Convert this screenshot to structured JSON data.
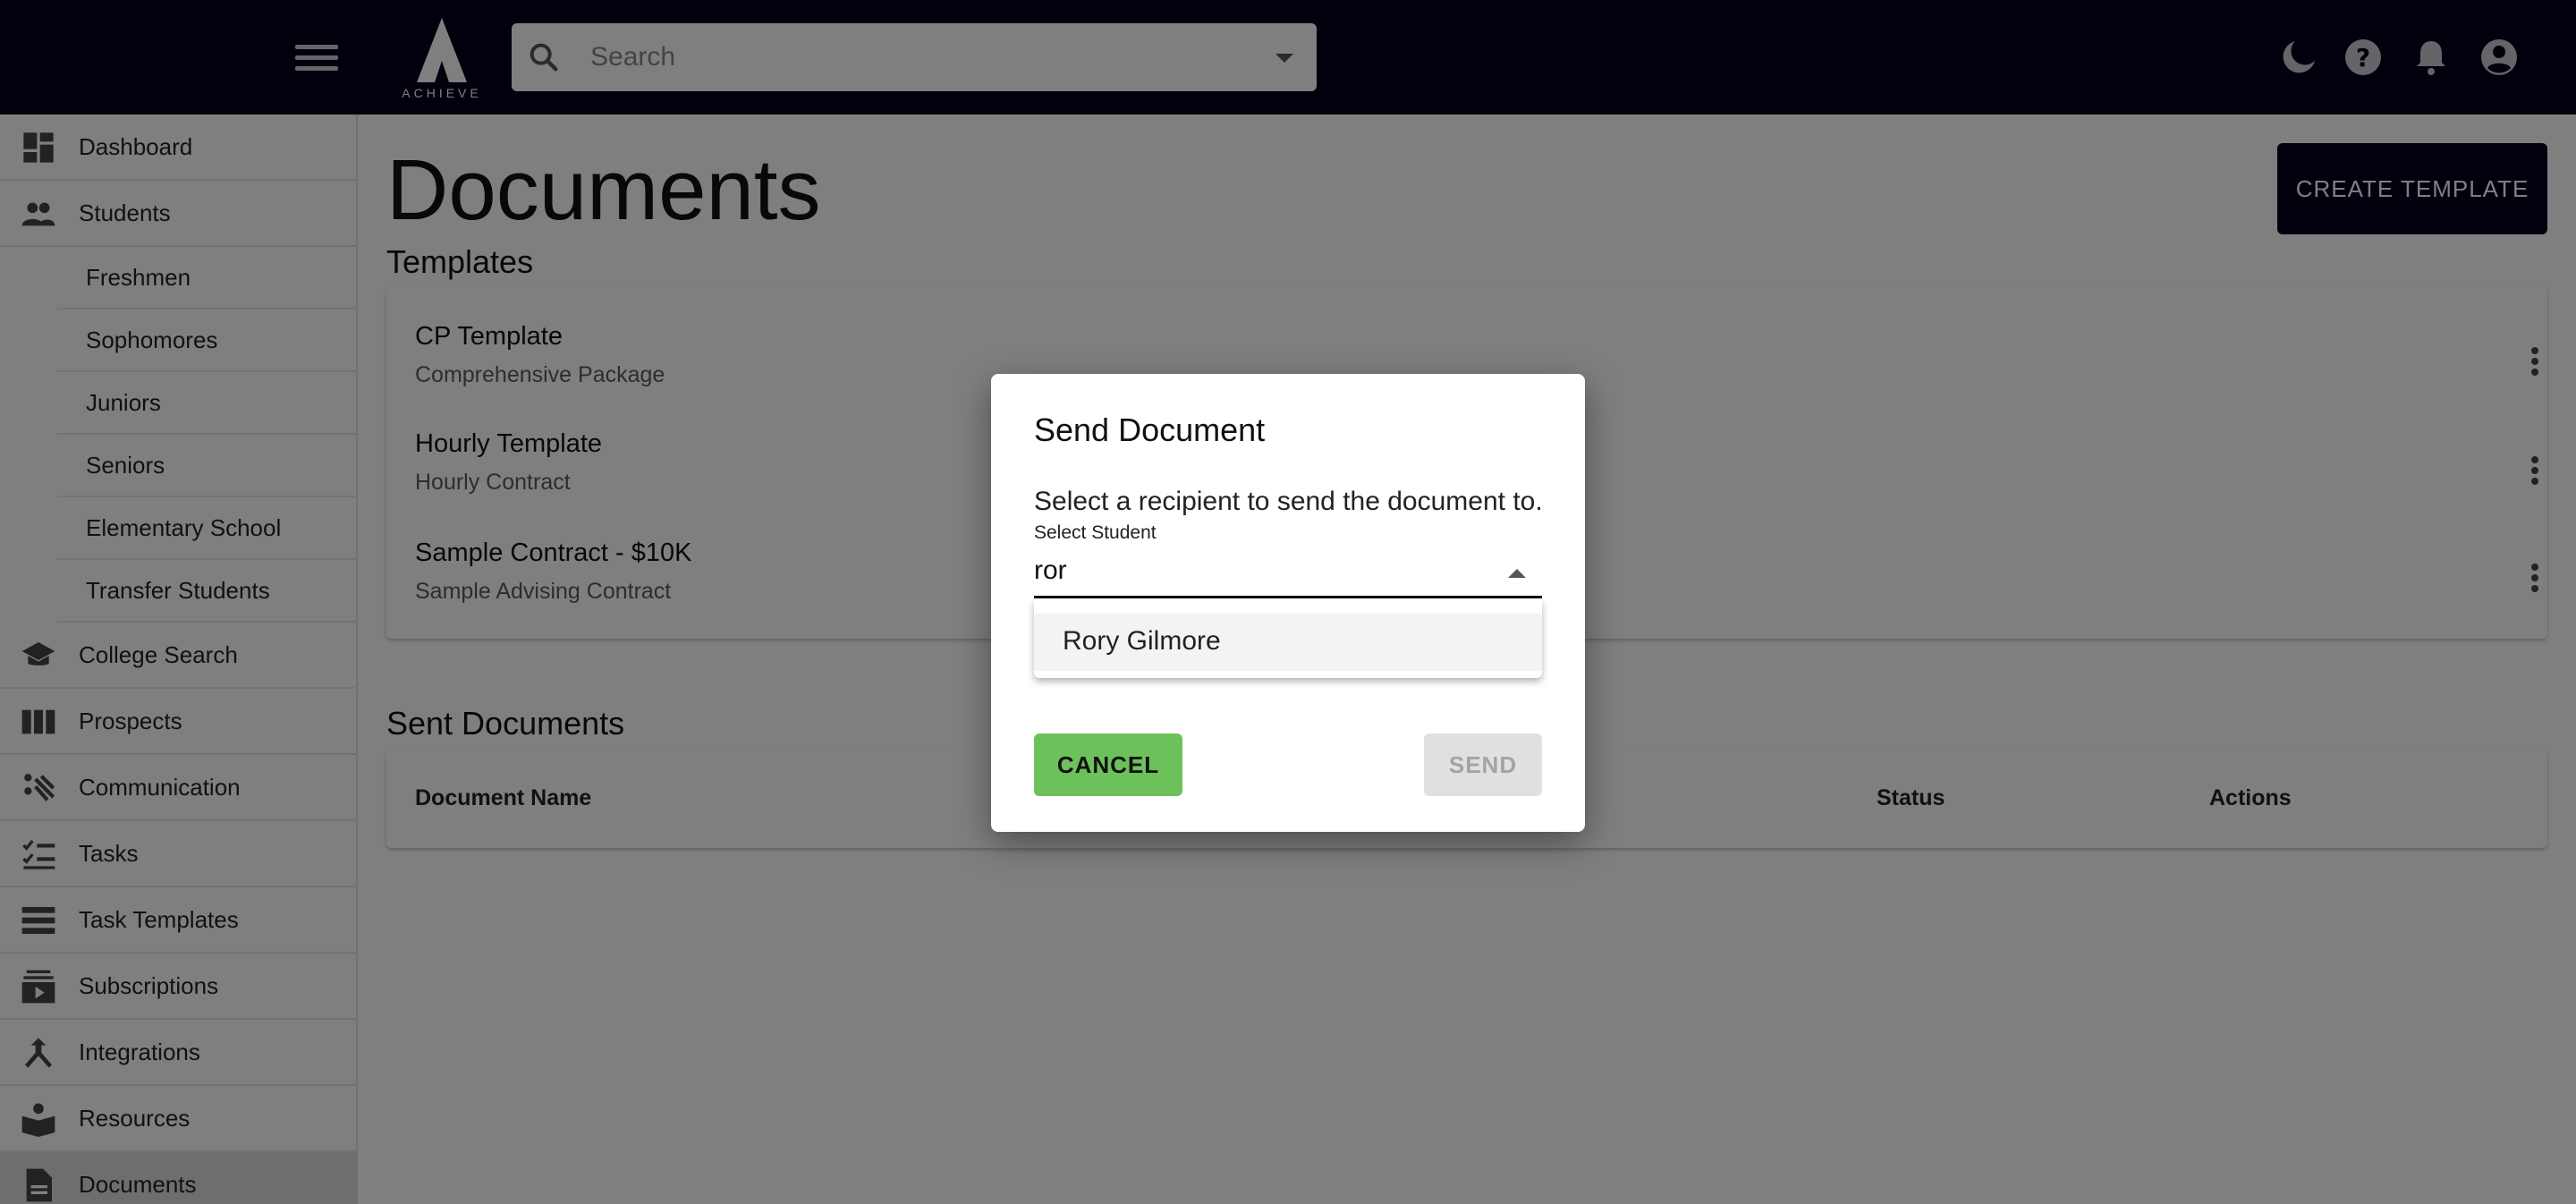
{
  "app": {
    "logo_text": "ACHIEVE"
  },
  "topbar": {
    "search_placeholder": "Search",
    "icons": [
      "dark-mode-icon",
      "help-icon",
      "notifications-icon",
      "account-icon"
    ]
  },
  "sidebar": {
    "items": [
      {
        "label": "Dashboard",
        "icon": "dashboard-icon"
      },
      {
        "label": "Students",
        "icon": "students-icon"
      },
      {
        "label": "Freshmen"
      },
      {
        "label": "Sophomores"
      },
      {
        "label": "Juniors"
      },
      {
        "label": "Seniors"
      },
      {
        "label": "Elementary School"
      },
      {
        "label": "Transfer Students"
      },
      {
        "label": "College Search",
        "icon": "graduation-cap-icon"
      },
      {
        "label": "Prospects",
        "icon": "columns-icon"
      },
      {
        "label": "Communication",
        "icon": "communication-icon"
      },
      {
        "label": "Tasks",
        "icon": "checklist-icon"
      },
      {
        "label": "Task Templates",
        "icon": "list-icon"
      },
      {
        "label": "Subscriptions",
        "icon": "subscriptions-icon"
      },
      {
        "label": "Integrations",
        "icon": "merge-icon"
      },
      {
        "label": "Resources",
        "icon": "book-icon"
      },
      {
        "label": "Documents",
        "icon": "document-icon"
      }
    ]
  },
  "main": {
    "title": "Documents",
    "create_template_label": "CREATE TEMPLATE",
    "templates_heading": "Templates",
    "templates": [
      {
        "title": "CP Template",
        "subtitle": "Comprehensive Package"
      },
      {
        "title": "Hourly Template",
        "subtitle": "Hourly Contract"
      },
      {
        "title": "Sample Contract - $10K",
        "subtitle": "Sample Advising Contract"
      }
    ],
    "sent_heading": "Sent Documents",
    "sent_columns": [
      "Document Name",
      "Status",
      "Actions"
    ]
  },
  "dialog": {
    "title": "Send Document",
    "text": "Select a recipient to send the document to.",
    "field_label": "Select Student",
    "field_value": "ror",
    "options": [
      "Rory Gilmore"
    ],
    "cancel_label": "CANCEL",
    "send_label": "SEND"
  }
}
